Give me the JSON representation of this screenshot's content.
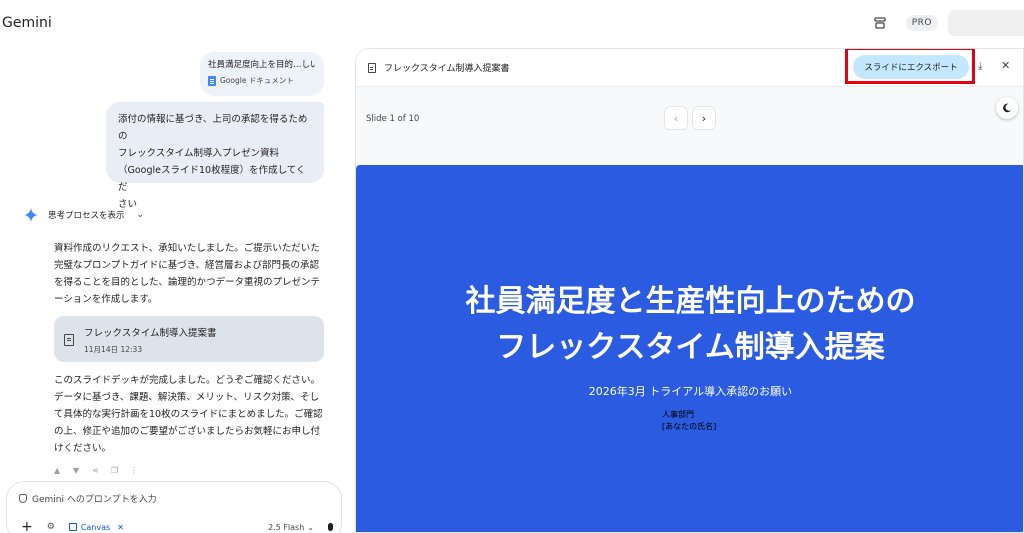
{
  "header": {
    "brand": "Gemini",
    "pro_label": "PRO"
  },
  "chat": {
    "attachment_bubble": {
      "text": "社員満足度向上を目的…しいで",
      "doc_label": "Google ドキュメント"
    },
    "user_message": [
      "添付の情報に基づき、上司の承認を得るための",
      "フレックスタイム制導入プレゼン資料",
      "（Googleスライド10枚程度）を作成してくだ",
      "さい"
    ],
    "thinking_label": "思考プロセスを表示",
    "response_1": [
      "資料作成のリクエスト、承知いたしました。ご提示いただいた",
      "完璧なプロンプトガイドに基づき、経営層および部門長の承認",
      "を得ることを目的とした、論理的かつデータ重視のプレゼンテ",
      "ーションを作成します。"
    ],
    "doc_card": {
      "title": "フレックスタイム制導入提案書",
      "date": "11月14日 12:33"
    },
    "response_2": [
      "このスライドデッキが完成しました。どうぞご確認ください。",
      "データに基づき、課題、解決策、メリット、リスク対策、そし",
      "て具体的な実行計画を10枚のスライドにまとめました。ご確認",
      "の上、修正や追加のご要望がございましたらお気軽にお申し付",
      "けください。"
    ],
    "prompt": {
      "placeholder": "Gemini へのプロンプトを入力",
      "canvas_label": "Canvas",
      "model_label": "2.5 Flash"
    }
  },
  "panel": {
    "doc_title": "フレックスタイム制導入提案書",
    "export_label": "スライドにエクスポート",
    "slide_counter": "Slide 1 of 10",
    "slide": {
      "title_line1": "社員満足度と生産性向上のための",
      "title_line2": "フレックスタイム制導入提案",
      "subtitle": "2026年3月 トライアル導入承認のお願い",
      "dept": "人事部門",
      "name": "[あなたの氏名]"
    }
  },
  "colors": {
    "slide_bg": "#2a5be0",
    "export_btn": "#c2e7ff",
    "highlight": "#e60012"
  }
}
